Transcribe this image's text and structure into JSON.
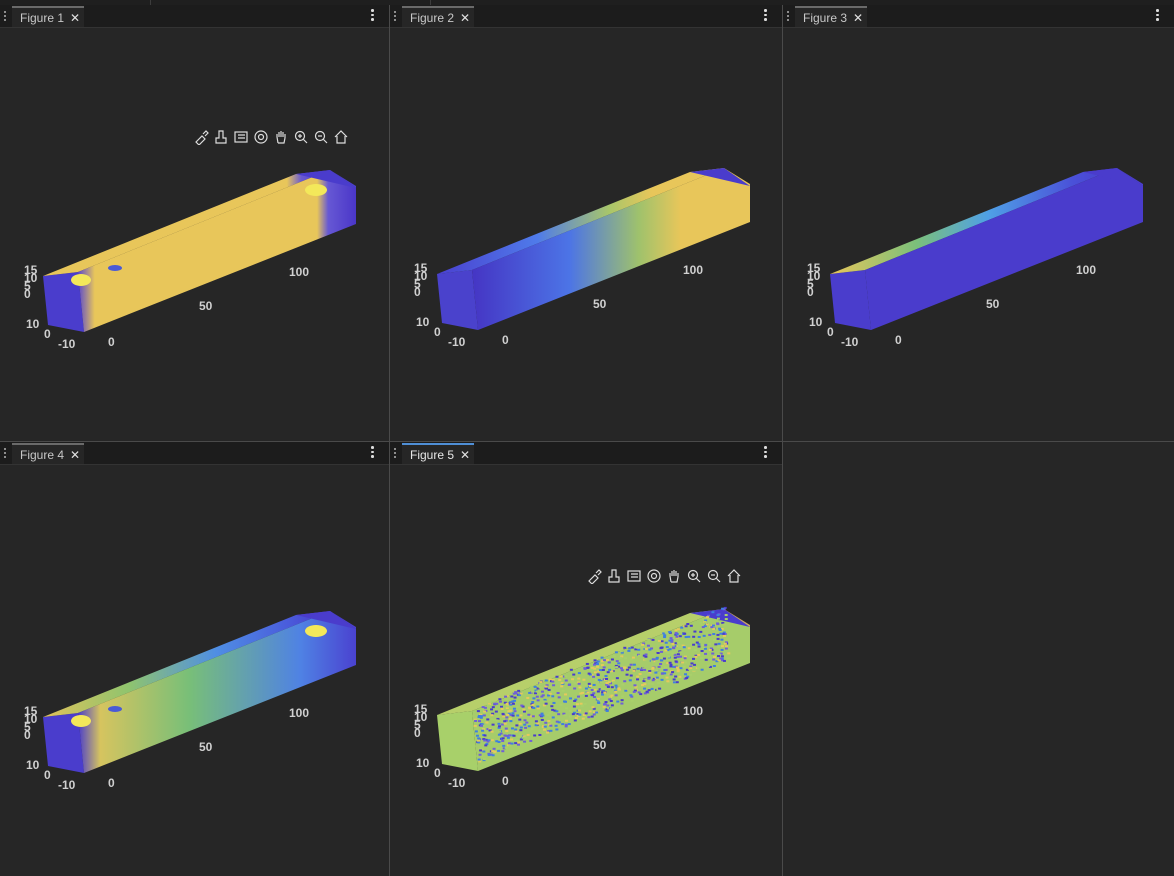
{
  "figures": [
    {
      "label": "Figure 1"
    },
    {
      "label": "Figure 2"
    },
    {
      "label": "Figure 3"
    },
    {
      "label": "Figure 4"
    },
    {
      "label": "Figure 5"
    }
  ],
  "active_figure": "Figure 5",
  "axes": {
    "z_ticks": [
      "15",
      "10",
      "5",
      "0"
    ],
    "y_ticks": [
      "10",
      "0",
      "-10"
    ],
    "x_ticks": [
      "0",
      "50",
      "100"
    ]
  },
  "close_glyph": "✕",
  "toolbar_icons": [
    "brush-icon",
    "data-tips-icon",
    "legend-icon",
    "rotate-3d-icon",
    "pan-icon",
    "zoom-in-icon",
    "zoom-out-icon",
    "home-icon"
  ],
  "colors": {
    "background": "#262626",
    "tabbar": "#1c1c1c",
    "active_tab_accent": "#4f8fd6",
    "colormap_low": "#4a36c8",
    "colormap_high": "#e8c65a"
  }
}
